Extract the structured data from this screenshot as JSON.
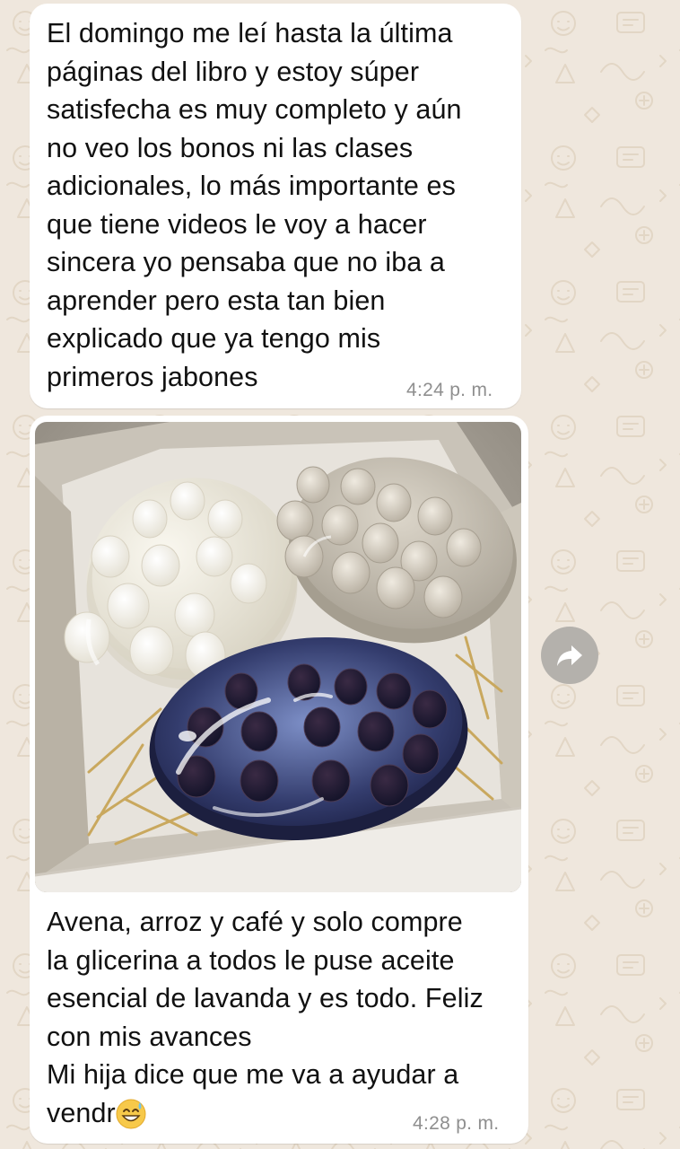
{
  "chat": {
    "messages": [
      {
        "text": "El domingo me leí hasta la última\npáginas del libro y estoy súper\nsatisfecha es muy completo y aún\nno veo los bonos ni las clases\nadicionales, lo más importante es\nque tiene videos le voy a hacer\nsincera yo pensaba que no iba a\naprender pero esta tan bien\nexplicado que ya tengo mis\nprimeros jabones",
        "time": "4:24 p. m."
      },
      {
        "caption_text": "Avena, arroz y café y solo compre\nla glicerina a todos le puse aceite\nesencial de lavanda y es todo. Feliz\ncon mis avances\nMi hija dice que me va a ayudar a\nvendr",
        "caption_emoji": "grinning-face-with-sweat-emoji",
        "time": "4:28 p. m."
      }
    ],
    "forward_icon": "forward-arrow-icon"
  },
  "colors": {
    "wallpaper": "#efe7dd",
    "bubble": "#ffffff",
    "timestamp": "#8f8f8f",
    "forward_button": "#b4b1ac"
  }
}
